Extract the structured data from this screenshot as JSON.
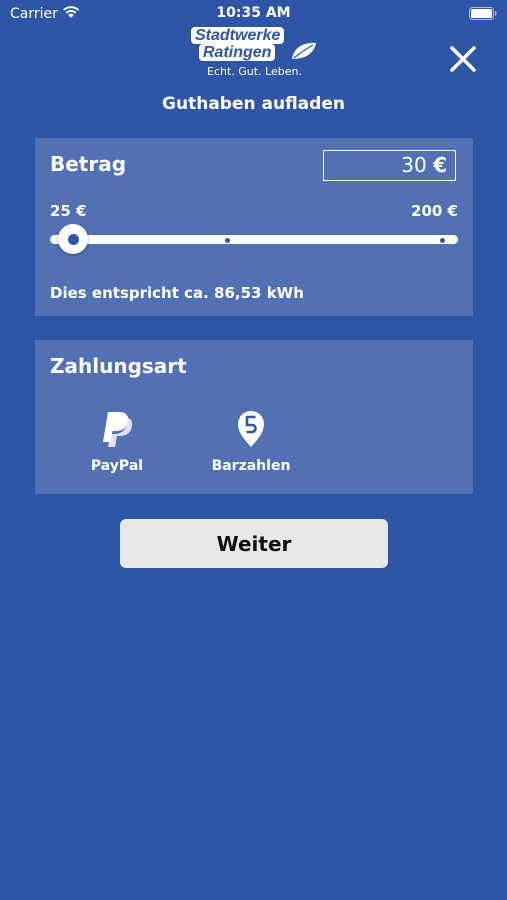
{
  "status_bar": {
    "carrier": "Carrier",
    "time": "10:35 AM"
  },
  "header": {
    "logo_line1": "Stadtwerke",
    "logo_line2": "Ratingen",
    "logo_tagline": "Echt. Gut. Leben.",
    "title": "Guthaben aufladen",
    "close_icon": "close-icon"
  },
  "amount": {
    "heading": "Betrag",
    "value": "30",
    "currency": "€",
    "min_label": "25 €",
    "max_label": "200 €",
    "slider_min": 25,
    "slider_max": 200,
    "slider_value": 30,
    "equivalent_text": "Dies entspricht ca. 86,53 kWh"
  },
  "payment": {
    "heading": "Zahlungsart",
    "options": [
      {
        "label": "PayPal",
        "icon": "paypal-icon"
      },
      {
        "label": "Barzahlen",
        "icon": "barzahlen-icon"
      }
    ]
  },
  "actions": {
    "next_label": "Weiter"
  },
  "colors": {
    "background": "#2f55a6",
    "panel": "rgba(255,255,255,0.17)",
    "button": "#e8e8e8",
    "text": "#ffffff"
  }
}
